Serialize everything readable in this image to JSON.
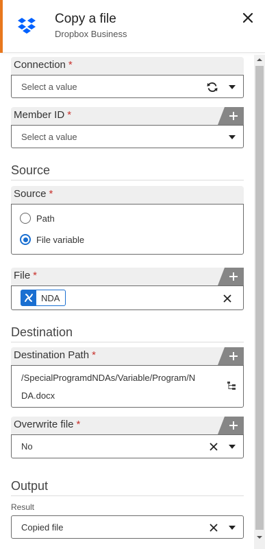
{
  "header": {
    "title": "Copy a file",
    "subtitle": "Dropbox Business",
    "accent_color": "#e8781e",
    "logo_icon": "dropbox-logo",
    "logo_color": "#0061ff"
  },
  "connection": {
    "label": "Connection",
    "required": "*",
    "placeholder": "Select a value"
  },
  "member_id": {
    "label": "Member ID",
    "required": "*",
    "placeholder": "Select a value"
  },
  "source_section": {
    "title": "Source"
  },
  "source": {
    "label": "Source",
    "required": "*",
    "options": [
      {
        "label": "Path",
        "checked": false
      },
      {
        "label": "File variable",
        "checked": true
      }
    ]
  },
  "file": {
    "label": "File",
    "required": "*",
    "chip": "NDA",
    "chip_icon": "variable-icon"
  },
  "destination_section": {
    "title": "Destination"
  },
  "destination_path": {
    "label": "Destination Path",
    "required": "*",
    "value_line1": "/SpecialProgramdNDAs/Variable/Program/N",
    "value_line2": "DA.docx"
  },
  "overwrite": {
    "label": "Overwrite file",
    "required": "*",
    "value": "No"
  },
  "output_section": {
    "title": "Output"
  },
  "result": {
    "label": "Result",
    "value": "Copied file"
  },
  "colors": {
    "required": "#c8312c",
    "accent_blue": "#1a6fd1",
    "tab_gray": "#868686"
  }
}
